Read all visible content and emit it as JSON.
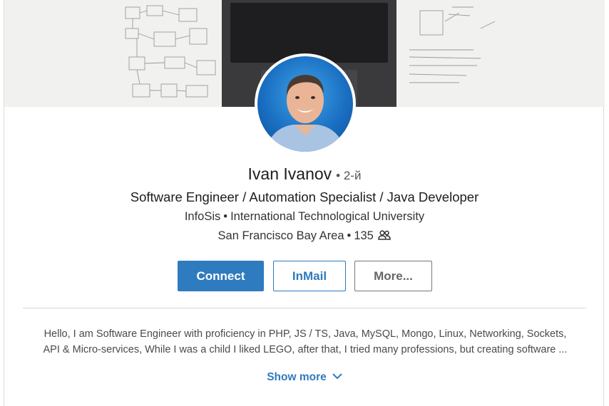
{
  "profile": {
    "name": "Ivan Ivanov",
    "degree": "• 2-й",
    "headline": "Software Engineer / Automation Specialist / Java Developer",
    "company": "InfoSis",
    "school": "International Technological University",
    "location": "San Francisco Bay Area",
    "connections": "135",
    "separator": "•"
  },
  "actions": {
    "connect_label": "Connect",
    "inmail_label": "InMail",
    "more_label": "More..."
  },
  "summary": {
    "line1": "Hello, I am Software Engineer with proficiency in PHP, JS / TS, Java, MySQL, Mongo, Linux, Networking, Sockets,",
    "line2": "API & Micro-services, While I was a child I liked LEGO, after that, I tried many professions, but creating software ...",
    "show_more_label": "Show more"
  },
  "icons": {
    "connections": "people-icon",
    "expand": "chevron-down-icon"
  },
  "colors": {
    "accent": "#2f7bbf",
    "text": "#1d1d1d",
    "muted": "#4a4a4a"
  }
}
